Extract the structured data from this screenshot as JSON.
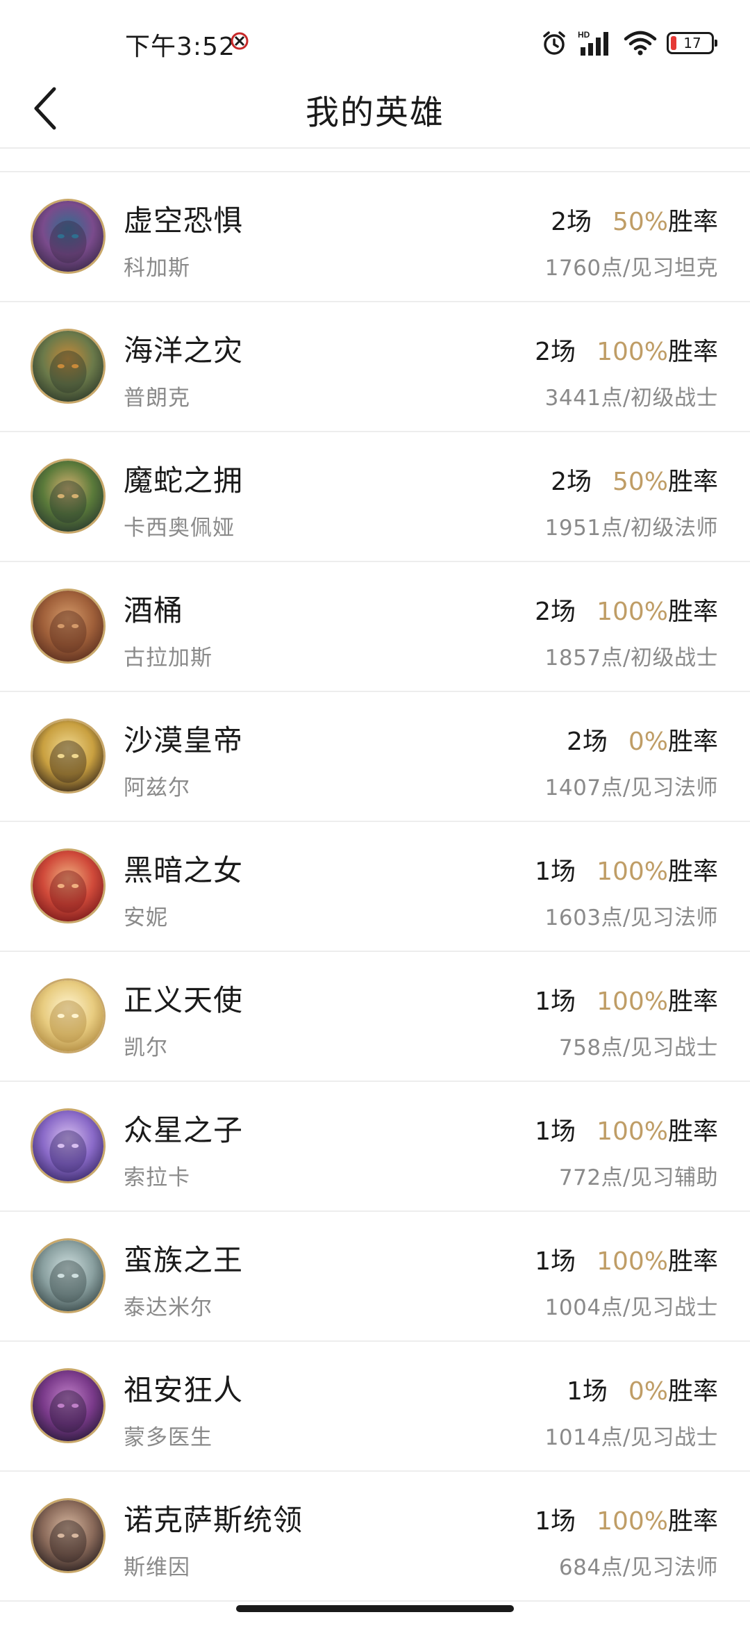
{
  "status_bar": {
    "time": "下午3:52",
    "network_label": "HD",
    "battery_level": "17",
    "battery_color": "#e53935"
  },
  "header": {
    "title": "我的英雄",
    "back_icon": "chevron-left-icon"
  },
  "colors": {
    "accent_gold": "#bf9d66",
    "secondary_text": "#8a8a8a",
    "divider": "#ededed",
    "avatar_border": "#c9a86a"
  },
  "labels": {
    "winrate_suffix": "胜率"
  },
  "heroes": [
    {
      "title": "虚空恐惧",
      "name": "科加斯",
      "games": "2场",
      "winrate": "50%",
      "points": "1760点/见习坦克"
    },
    {
      "title": "海洋之灾",
      "name": "普朗克",
      "games": "2场",
      "winrate": "100%",
      "points": "3441点/初级战士"
    },
    {
      "title": "魔蛇之拥",
      "name": "卡西奥佩娅",
      "games": "2场",
      "winrate": "50%",
      "points": "1951点/初级法师"
    },
    {
      "title": "酒桶",
      "name": "古拉加斯",
      "games": "2场",
      "winrate": "100%",
      "points": "1857点/初级战士"
    },
    {
      "title": "沙漠皇帝",
      "name": "阿兹尔",
      "games": "2场",
      "winrate": "0%",
      "points": "1407点/见习法师"
    },
    {
      "title": "黑暗之女",
      "name": "安妮",
      "games": "1场",
      "winrate": "100%",
      "points": "1603点/见习法师"
    },
    {
      "title": "正义天使",
      "name": "凯尔",
      "games": "1场",
      "winrate": "100%",
      "points": "758点/见习战士"
    },
    {
      "title": "众星之子",
      "name": "索拉卡",
      "games": "1场",
      "winrate": "100%",
      "points": "772点/见习辅助"
    },
    {
      "title": "蛮族之王",
      "name": "泰达米尔",
      "games": "1场",
      "winrate": "100%",
      "points": "1004点/见习战士"
    },
    {
      "title": "祖安狂人",
      "name": "蒙多医生",
      "games": "1场",
      "winrate": "0%",
      "points": "1014点/见习战士"
    },
    {
      "title": "诺克萨斯统领",
      "name": "斯维因",
      "games": "1场",
      "winrate": "100%",
      "points": "684点/见习法师"
    }
  ]
}
